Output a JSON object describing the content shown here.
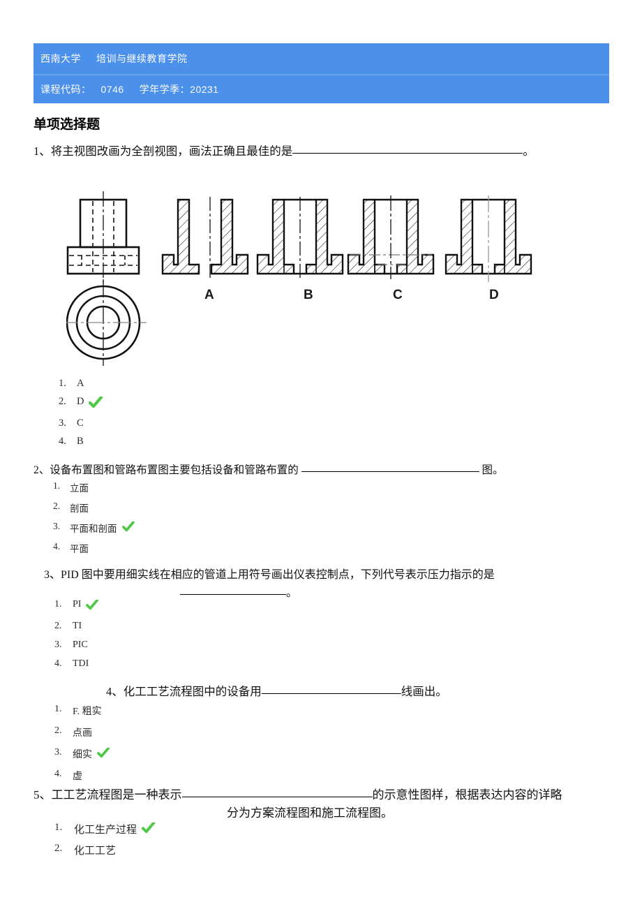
{
  "header": {
    "institution": "西南大学",
    "department": "培训与继续教育学院",
    "course_code_label": "课程代码：",
    "course_code_value": "0746",
    "term_label": "学年学季：",
    "term_value": "20231",
    "accent_color": "#4b90ea"
  },
  "section": {
    "title": "单项选择题"
  },
  "check_color": "#4dc945",
  "questions": [
    {
      "number": "1、",
      "prefix": "将主视图改画为全剖视图，画法正确且最佳的是",
      "suffix": "。",
      "options": [
        {
          "num": "1.",
          "text": "A",
          "correct": false
        },
        {
          "num": "2.",
          "text": "D",
          "correct": true
        },
        {
          "num": "3.",
          "text": "C",
          "correct": false
        },
        {
          "num": "4.",
          "text": "B",
          "correct": false
        }
      ]
    },
    {
      "number": "2、",
      "prefix": "设备布置图和管路布置图主要包括设备和管路布置的",
      "suffix": "图。",
      "options": [
        {
          "num": "1.",
          "text": "立面",
          "correct": false
        },
        {
          "num": "2.",
          "text": "剖面",
          "correct": false
        },
        {
          "num": "3.",
          "text": "平面和剖面",
          "correct": true
        },
        {
          "num": "4.",
          "text": "平面",
          "correct": false
        }
      ]
    },
    {
      "number": "3、",
      "prefix": "PID 图中要用细实线在相应的管道上用符号画出仪表控制点，下列代号表示压力指示的是",
      "suffix": "。",
      "options": [
        {
          "num": "1.",
          "text": "PI",
          "correct": true
        },
        {
          "num": "2.",
          "text": "TI",
          "correct": false
        },
        {
          "num": "3.",
          "text": "PIC",
          "correct": false
        },
        {
          "num": "4.",
          "text": "TDI",
          "correct": false
        }
      ]
    },
    {
      "number": "4、",
      "prefix": "化工工艺流程图中的设备用",
      "suffix": "线画出。",
      "options": [
        {
          "num": "1.",
          "text": "F. 粗实",
          "correct": false
        },
        {
          "num": "2.",
          "text": "点画",
          "correct": false
        },
        {
          "num": "3.",
          "text": "细实",
          "correct": true
        },
        {
          "num": "4.",
          "text": "虚",
          "correct": false
        }
      ]
    },
    {
      "number": "5、",
      "prefix": "工工艺流程图是一种表示",
      "suffix": "的示意性图样，根据表达内容的详略",
      "line2": "分为方案流程图和施工流程图。",
      "options": [
        {
          "num": "1.",
          "text": "化工生产过程",
          "correct": true
        },
        {
          "num": "2.",
          "text": "化工工艺",
          "correct": false
        }
      ]
    }
  ],
  "figure": {
    "labels": [
      "A",
      "B",
      "C",
      "D"
    ],
    "description": "机件三视图与四个全剖视图画法对比"
  }
}
